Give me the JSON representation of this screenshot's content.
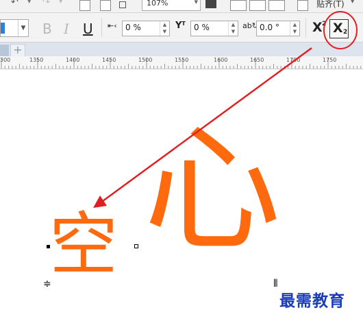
{
  "toolbar_top": {
    "zoom_value": "107%",
    "snap_label": "贴齐(T)"
  },
  "text_toolbar": {
    "bold_label": "B",
    "italic_label": "I",
    "underline_label": "U",
    "char_spacing_value": "0 %",
    "baseline_value": "0 %",
    "rotation_value": "0.0 °",
    "superscript_main": "X",
    "superscript_small": "2",
    "subscript_main": "X",
    "subscript_small": "2"
  },
  "doc_tabs": {
    "add_label": "+"
  },
  "ruler": {
    "labels": [
      "300",
      "1350",
      "1400",
      "1450",
      "1500",
      "1550",
      "1600",
      "1650",
      "1700",
      "1750"
    ]
  },
  "canvas": {
    "text_small": "空",
    "text_large": "心",
    "text_color": "#ff6a0f"
  },
  "annotation": {
    "color": "#e02020"
  },
  "watermark": "最需教育"
}
